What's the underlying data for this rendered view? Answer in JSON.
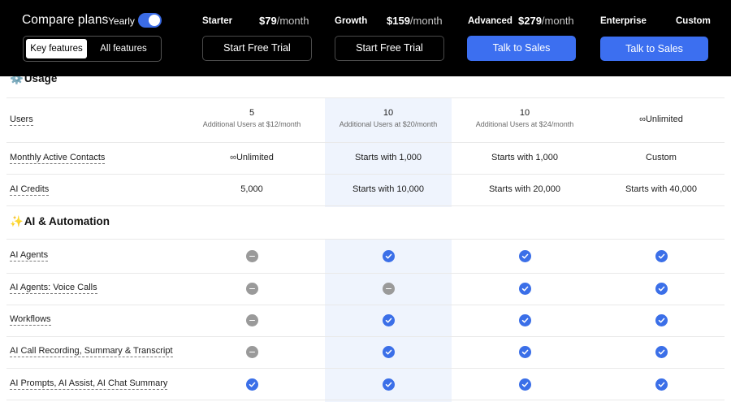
{
  "header": {
    "title": "Compare plans",
    "billing_label": "Yearly",
    "billing_toggle_on": true,
    "tabs": [
      "Key features",
      "All features"
    ],
    "plans": [
      {
        "name": "Starter",
        "price": "$79",
        "period": "/month",
        "cta": "Start Free Trial",
        "cta_style": "outline"
      },
      {
        "name": "Growth",
        "price": "$159",
        "period": "/month",
        "cta": "Start Free Trial",
        "cta_style": "outline"
      },
      {
        "name": "Advanced",
        "price": "$279",
        "period": "/month",
        "cta": "Talk to Sales",
        "cta_style": "blue"
      },
      {
        "name": "Enterprise",
        "price_text": "Custom",
        "cta": "Talk to Sales",
        "cta_style": "blue"
      }
    ]
  },
  "sections": {
    "usage": {
      "icon": "⚙️",
      "title": "Usage"
    },
    "ai": {
      "icon": "✨",
      "title": "AI & Automation"
    }
  },
  "usage_rows": [
    {
      "feature": "Users",
      "values": [
        {
          "main": "5",
          "sub": "Additional Users at $12/month"
        },
        {
          "main": "10",
          "sub": "Additional Users at $20/month"
        },
        {
          "main": "10",
          "sub": "Additional Users at $24/month"
        },
        {
          "main": "∞Unlimited",
          "sub": ""
        }
      ]
    },
    {
      "feature": "Monthly Active Contacts",
      "values": [
        {
          "main": "∞Unlimited"
        },
        {
          "main": "Starts with 1,000"
        },
        {
          "main": "Starts with 1,000"
        },
        {
          "main": "Custom"
        }
      ]
    },
    {
      "feature": "AI Credits",
      "values": [
        {
          "main": "5,000"
        },
        {
          "main": "Starts with 10,000"
        },
        {
          "main": "Starts with 20,000"
        },
        {
          "main": "Starts with 40,000"
        }
      ]
    }
  ],
  "ai_rows": [
    {
      "feature": "AI Agents",
      "values": [
        "minus-icon",
        "check-icon",
        "check-icon",
        "check-icon"
      ]
    },
    {
      "feature": "AI Agents: Voice Calls",
      "values": [
        "minus-icon",
        "minus-icon",
        "check-icon",
        "check-icon"
      ]
    },
    {
      "feature": "Workflows",
      "values": [
        "minus-icon",
        "check-icon",
        "check-icon",
        "check-icon"
      ]
    },
    {
      "feature": "AI Call Recording, Summary & Transcript",
      "values": [
        "minus-icon",
        "check-icon",
        "check-icon",
        "check-icon"
      ]
    },
    {
      "feature": "AI Prompts, AI Assist, AI Chat Summary",
      "values": [
        "check-icon",
        "check-icon",
        "check-icon",
        "check-icon"
      ]
    }
  ],
  "colors": {
    "header_bg": "#000000",
    "accent_blue": "#3c6ff0",
    "highlight_column": "#eff4fd",
    "check": "#3b6fe8",
    "minus": "#9a9a9a"
  }
}
